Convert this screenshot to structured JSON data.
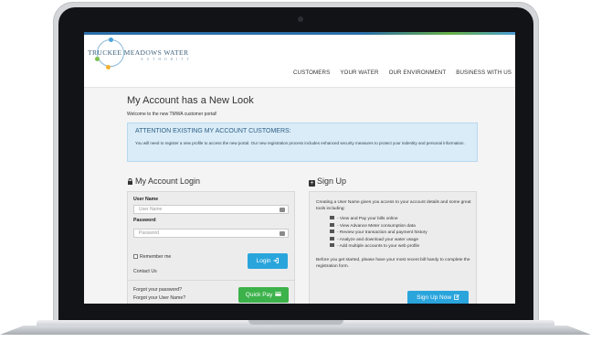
{
  "logo": {
    "line1": "TRUCKEE MEADOWS WATER",
    "line2": "AUTHORITY"
  },
  "nav": {
    "items": [
      "CUSTOMERS",
      "YOUR WATER",
      "OUR ENVIRONMENT",
      "BUSINESS WITH US"
    ]
  },
  "page": {
    "title": "My Account has a New Look",
    "subtitle": "Welcome to the new TMWA customer portal!"
  },
  "notice": {
    "title": "ATTENTION EXISTING MY ACCOUNT CUSTOMERS:",
    "text": "You will need to register a new profile to access the new portal. Our new registration process includes enhanced security measures to protect your indentity and personal information."
  },
  "login": {
    "heading": "My Account Login",
    "username_label": "User Name",
    "username_placeholder": "User Name",
    "password_label": "Password",
    "password_placeholder": "Password",
    "remember_label": "Remember me",
    "contact_label": "Contact Us",
    "login_button": "Login",
    "forgot_password": "Forgot your password?",
    "forgot_username": "Forgot your User Name?",
    "quickpay_button": "Quick Pay"
  },
  "signup": {
    "heading": "Sign Up",
    "intro": "Creating a User Name gives you access to your account details and some great tools including:",
    "features": [
      "- View and Pay your bills online",
      "- View Advance Meter consumption data",
      "- Review your transaction and payment history",
      "- Analyze and download your water usage",
      "- Add multiple accounts to your web profile"
    ],
    "outro": "Before you get started, please have your most recent bill handy to complete the registration form.",
    "button": "Sign Up Now"
  },
  "colors": {
    "primary_button": "#2aa5dc",
    "quickpay_button": "#3cb24a",
    "notice_bg": "#d9ecf7",
    "notice_title": "#2e5e86"
  },
  "icons": {
    "login_heading": "lock-icon",
    "signup_heading": "plus-square-icon",
    "login_button": "sign-in-icon",
    "quickpay_button": "credit-card-icon",
    "signup_button": "edit-icon",
    "input_field": "card-icon"
  }
}
